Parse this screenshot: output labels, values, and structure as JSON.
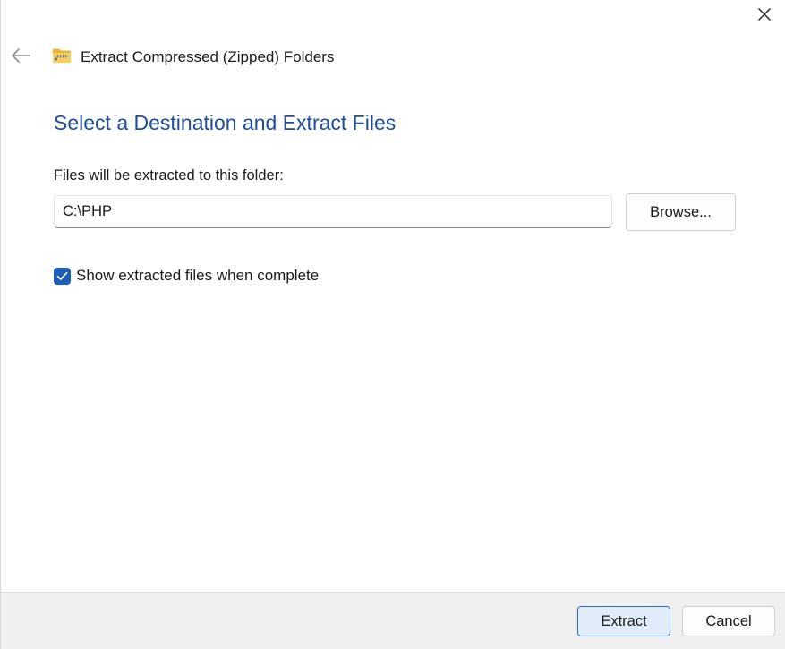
{
  "window": {
    "title": "Extract Compressed (Zipped) Folders",
    "close_icon": "close-icon",
    "back_icon": "back-arrow-icon",
    "folder_icon": "zipped-folder-icon"
  },
  "main": {
    "heading": "Select a Destination and Extract Files",
    "destination_label": "Files will be extracted to this folder:",
    "destination_value": "C:\\PHP",
    "browse_label": "Browse...",
    "show_files_label": "Show extracted files when complete",
    "show_files_checked": true
  },
  "footer": {
    "extract_label": "Extract",
    "cancel_label": "Cancel"
  },
  "colors": {
    "heading": "#1e4c9a",
    "accent": "#1d5fb4",
    "footer_bg": "#f0f0f0",
    "primary_button_bg": "#e0ecfa",
    "primary_button_border": "#2b6cc4"
  }
}
